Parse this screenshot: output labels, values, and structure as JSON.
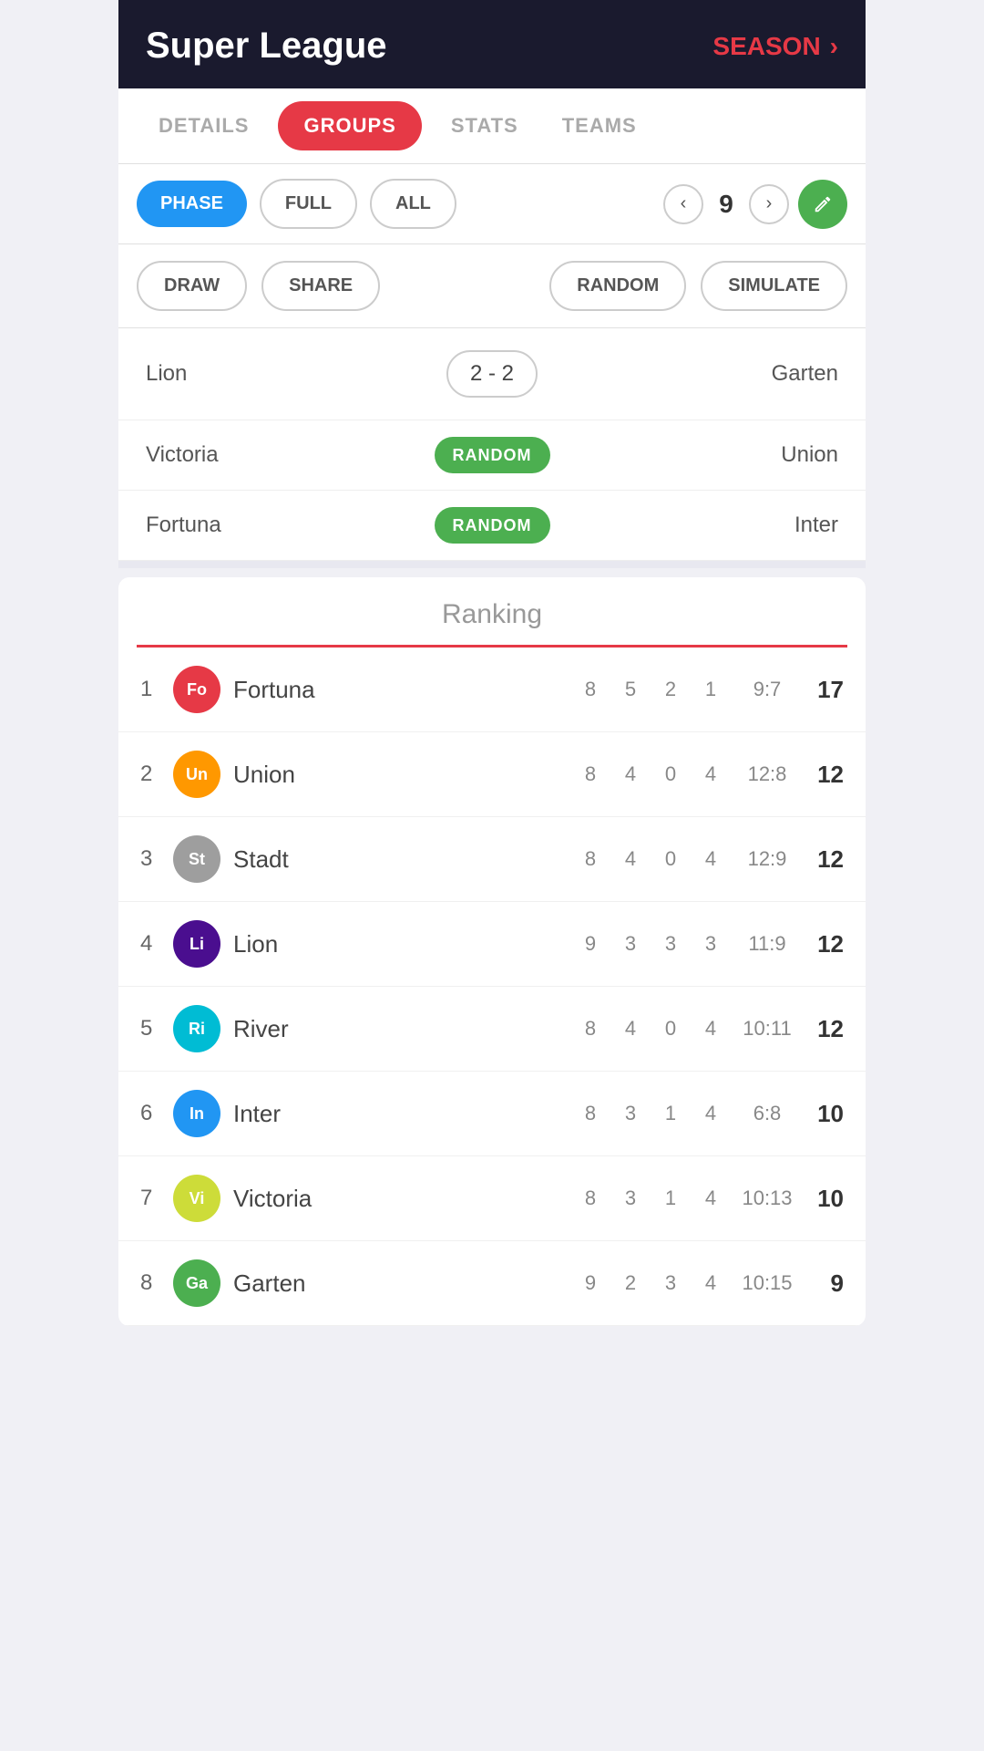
{
  "header": {
    "title": "Super League",
    "season_label": "SEASON",
    "chevron": "›"
  },
  "tabs": [
    {
      "id": "details",
      "label": "DETAILS",
      "active": false
    },
    {
      "id": "groups",
      "label": "GROUPS",
      "active": true
    },
    {
      "id": "stats",
      "label": "STATS",
      "active": false
    },
    {
      "id": "teams",
      "label": "TEAMS",
      "active": false
    }
  ],
  "filters": {
    "phase": "PHASE",
    "full": "FULL",
    "all": "ALL",
    "round_number": "9"
  },
  "actions": {
    "draw": "DRAW",
    "share": "SHARE",
    "random": "RANDOM",
    "simulate": "SIMULATE"
  },
  "matches": [
    {
      "home": "Lion",
      "score": "2 - 2",
      "away": "Garten",
      "type": "score"
    },
    {
      "home": "Victoria",
      "score": "RANDOM",
      "away": "Union",
      "type": "random"
    },
    {
      "home": "Fortuna",
      "score": "RANDOM",
      "away": "Inter",
      "type": "random"
    }
  ],
  "ranking": {
    "title": "Ranking",
    "rows": [
      {
        "pos": 1,
        "abbr": "Fo",
        "color": "#e63946",
        "name": "Fortuna",
        "p": 8,
        "w": 5,
        "d": 2,
        "l": 1,
        "gd": "9:7",
        "pts": 17
      },
      {
        "pos": 2,
        "abbr": "Un",
        "color": "#FF9800",
        "name": "Union",
        "p": 8,
        "w": 4,
        "d": 0,
        "l": 4,
        "gd": "12:8",
        "pts": 12
      },
      {
        "pos": 3,
        "abbr": "St",
        "color": "#9E9E9E",
        "name": "Stadt",
        "p": 8,
        "w": 4,
        "d": 0,
        "l": 4,
        "gd": "12:9",
        "pts": 12
      },
      {
        "pos": 4,
        "abbr": "Li",
        "color": "#4a0e8f",
        "name": "Lion",
        "p": 9,
        "w": 3,
        "d": 3,
        "l": 3,
        "gd": "11:9",
        "pts": 12
      },
      {
        "pos": 5,
        "abbr": "Ri",
        "color": "#00BCD4",
        "name": "River",
        "p": 8,
        "w": 4,
        "d": 0,
        "l": 4,
        "gd": "10:11",
        "pts": 12
      },
      {
        "pos": 6,
        "abbr": "In",
        "color": "#2196F3",
        "name": "Inter",
        "p": 8,
        "w": 3,
        "d": 1,
        "l": 4,
        "gd": "6:8",
        "pts": 10
      },
      {
        "pos": 7,
        "abbr": "Vi",
        "color": "#CDDC39",
        "name": "Victoria",
        "p": 8,
        "w": 3,
        "d": 1,
        "l": 4,
        "gd": "10:13",
        "pts": 10
      },
      {
        "pos": 8,
        "abbr": "Ga",
        "color": "#4CAF50",
        "name": "Garten",
        "p": 9,
        "w": 2,
        "d": 3,
        "l": 4,
        "gd": "10:15",
        "pts": 9
      }
    ]
  }
}
